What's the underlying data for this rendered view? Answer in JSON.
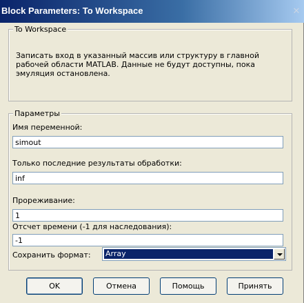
{
  "window": {
    "title": "Block Parameters: To Workspace"
  },
  "description_group": {
    "legend": "To Workspace",
    "text": "Записать вход в указанный массив или структуру в главной рабочей области MATLAB. Данные не будут доступны, пока эмуляция остановлена."
  },
  "params_group": {
    "legend": "Параметры",
    "variable_name": {
      "label": "Имя переменной:",
      "value": "simout"
    },
    "last_results": {
      "label": "Только последние результаты обработки:",
      "value": "inf"
    },
    "decimation": {
      "label": "Прореживание:",
      "value": "1"
    },
    "sample_time": {
      "label": "Отсчет времени (-1 для наследования):",
      "value": "-1"
    },
    "save_format": {
      "label": "Сохранить формат:",
      "value": "Array"
    }
  },
  "buttons": {
    "ok": "OK",
    "cancel": "Отмена",
    "help": "Помощь",
    "apply": "Принять"
  },
  "colors": {
    "titlebar_start": "#0a246a",
    "titlebar_end": "#a6caf0",
    "dialog_bg": "#ece9d8",
    "selection": "#0a246a"
  }
}
